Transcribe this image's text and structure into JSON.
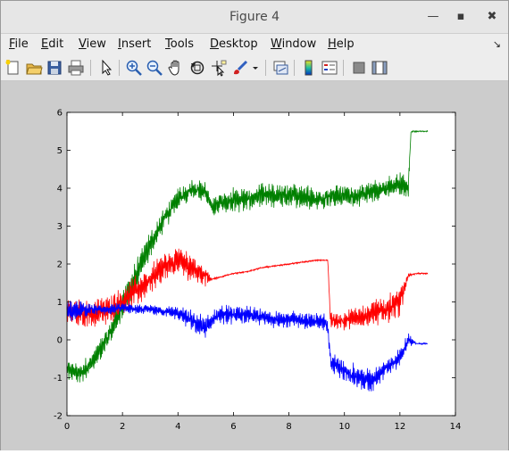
{
  "window": {
    "title": "Figure 4"
  },
  "menu": [
    {
      "label": "File",
      "u": "F",
      "rest": "ile"
    },
    {
      "label": "Edit",
      "u": "E",
      "rest": "dit"
    },
    {
      "label": "View",
      "u": "V",
      "rest": "iew"
    },
    {
      "label": "Insert",
      "u": "I",
      "rest": "nsert"
    },
    {
      "label": "Tools",
      "u": "T",
      "rest": "ools"
    },
    {
      "label": "Desktop",
      "u": "D",
      "rest": "esktop"
    },
    {
      "label": "Window",
      "u": "W",
      "rest": "indow"
    },
    {
      "label": "Help",
      "u": "H",
      "rest": "elp"
    }
  ],
  "toolbar_icons": [
    "new-figure-icon",
    "open-file-icon",
    "save-icon",
    "print-icon",
    "select-arrow-icon",
    "zoom-in-icon",
    "zoom-out-icon",
    "pan-hand-icon",
    "rotate-3d-icon",
    "data-cursor-icon",
    "brush-icon",
    "brush-dropdown-icon",
    "link-plot-icon",
    "colorbar-icon",
    "legend-icon",
    "hide-plot-tools-icon",
    "show-plot-tools-icon"
  ],
  "colors": {
    "series1": "#008000",
    "series2": "#ff0000",
    "series3": "#0000ff"
  },
  "chart_data": {
    "type": "line",
    "title": "",
    "xlabel": "",
    "ylabel": "",
    "xlim": [
      0,
      14
    ],
    "ylim": [
      -2,
      6
    ],
    "xticks": [
      "0",
      "2",
      "4",
      "6",
      "8",
      "10",
      "12",
      "14"
    ],
    "yticks": [
      "-2",
      "-1",
      "0",
      "1",
      "2",
      "3",
      "4",
      "5",
      "6"
    ],
    "grid": false,
    "series": [
      {
        "color": "#008000",
        "x": [
          0,
          0.5,
          1,
          1.5,
          2,
          2.5,
          3,
          3.5,
          4,
          4.5,
          5,
          5.2,
          5.5,
          6,
          6.5,
          7,
          7.5,
          8,
          8.5,
          9,
          9.5,
          10,
          10.5,
          11,
          11.5,
          12,
          12.3,
          12.4,
          12.6,
          13.0
        ],
        "y": [
          -0.8,
          -0.9,
          -0.5,
          0.1,
          0.9,
          1.7,
          2.5,
          3.2,
          3.7,
          4.0,
          3.9,
          3.5,
          3.6,
          3.7,
          3.7,
          3.8,
          3.8,
          3.8,
          3.8,
          3.7,
          3.8,
          3.8,
          3.8,
          3.9,
          4.0,
          4.1,
          4.0,
          5.5,
          5.5,
          5.5
        ],
        "noise": [
          0.3,
          0.3,
          0.3,
          0.35,
          0.4,
          0.45,
          0.4,
          0.35,
          0.3,
          0.3,
          0.3,
          0.25,
          0.3,
          0.35,
          0.35,
          0.35,
          0.35,
          0.35,
          0.35,
          0.3,
          0.3,
          0.3,
          0.3,
          0.3,
          0.35,
          0.35,
          0.3,
          0.03,
          0.02,
          0.02
        ]
      },
      {
        "color": "#ff0000",
        "x": [
          0,
          0.5,
          1,
          1.5,
          2,
          2.5,
          3,
          3.5,
          4,
          4.5,
          5,
          5.2,
          5.5,
          6,
          6.5,
          7,
          7.5,
          8,
          8.5,
          9,
          9.4,
          9.5,
          10,
          10.5,
          11,
          11.5,
          12,
          12.3,
          12.6,
          13.0
        ],
        "y": [
          0.8,
          0.7,
          0.7,
          0.8,
          1.0,
          1.3,
          1.6,
          1.9,
          2.1,
          1.9,
          1.7,
          1.6,
          1.65,
          1.75,
          1.8,
          1.9,
          1.95,
          2.0,
          2.05,
          2.1,
          2.1,
          0.5,
          0.5,
          0.6,
          0.7,
          0.8,
          1.0,
          1.7,
          1.75,
          1.75
        ],
        "noise": [
          0.4,
          0.4,
          0.4,
          0.4,
          0.4,
          0.45,
          0.45,
          0.45,
          0.45,
          0.4,
          0.3,
          0.03,
          0.02,
          0.02,
          0.02,
          0.02,
          0.02,
          0.02,
          0.02,
          0.02,
          0.02,
          0.25,
          0.3,
          0.3,
          0.35,
          0.4,
          0.45,
          0.05,
          0.02,
          0.02
        ]
      },
      {
        "color": "#0000ff",
        "x": [
          0,
          0.5,
          1,
          1.5,
          2,
          2.5,
          3,
          3.5,
          4,
          4.5,
          5,
          5.5,
          6,
          6.5,
          7,
          7.5,
          8,
          8.5,
          9,
          9.4,
          9.5,
          10,
          10.5,
          11,
          11.5,
          12,
          12.3,
          12.6,
          13.0
        ],
        "y": [
          0.7,
          0.8,
          0.8,
          0.8,
          0.85,
          0.8,
          0.8,
          0.75,
          0.7,
          0.5,
          0.3,
          0.7,
          0.65,
          0.65,
          0.6,
          0.55,
          0.55,
          0.5,
          0.5,
          0.4,
          -0.6,
          -0.8,
          -1.0,
          -1.1,
          -0.7,
          -0.5,
          0.0,
          -0.1,
          -0.1
        ],
        "noise": [
          0.35,
          0.25,
          0.15,
          0.15,
          0.15,
          0.15,
          0.15,
          0.15,
          0.2,
          0.3,
          0.35,
          0.3,
          0.25,
          0.25,
          0.25,
          0.25,
          0.25,
          0.25,
          0.25,
          0.3,
          0.3,
          0.3,
          0.35,
          0.35,
          0.3,
          0.3,
          0.2,
          0.02,
          0.02
        ]
      }
    ]
  }
}
